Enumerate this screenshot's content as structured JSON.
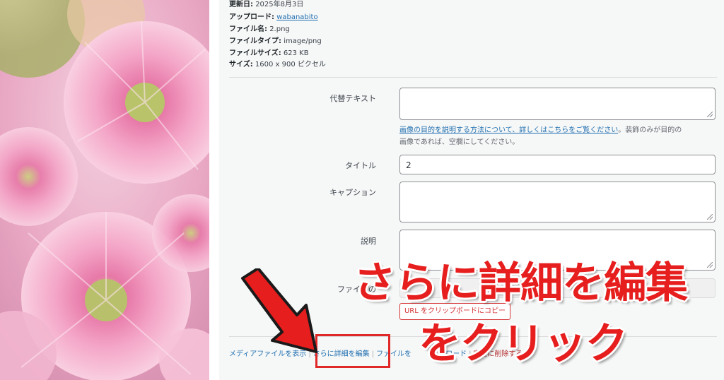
{
  "details": {
    "updated_label": "更新日:",
    "updated_value": "2025年8月3日",
    "uploader_label": "アップロード:",
    "uploader_value": "wabanabito",
    "filename_label": "ファイル名:",
    "filename_value": "2.png",
    "filetype_label": "ファイルタイプ:",
    "filetype_value": "image/png",
    "filesize_label": "ファイルサイズ:",
    "filesize_value": "623 KB",
    "size_label": "サイズ:",
    "size_value": "1600 x 900 ピクセル"
  },
  "form": {
    "alt_label": "代替テキスト",
    "alt_value": "",
    "alt_help_link": "画像の目的を説明する方法について、詳しくはこちらをご覧ください",
    "alt_help_text_1": "。装飾のみが目的の",
    "alt_help_text_2": "画像であれば、空欄にしてください。",
    "title_label": "タイトル",
    "title_value": "2",
    "caption_label": "キャプション",
    "caption_value": "",
    "description_label": "説明",
    "description_value": "",
    "file_url_label": "ファイルの",
    "file_url_value": "",
    "copy_url_button": "URL をクリップボードにコピー"
  },
  "actions": {
    "view_media": "メディアファイルを表示",
    "edit_more": "さらに詳細を編集",
    "download": "ファイルを",
    "download_tail": "ロード",
    "delete": "完全に削除する",
    "separator": "|"
  },
  "overlay": {
    "line1": "さらに詳細を編集",
    "line2": "をクリック",
    "color": "#e61e1e"
  },
  "photo": {
    "subject": "pink chrysanthemum flowers"
  }
}
